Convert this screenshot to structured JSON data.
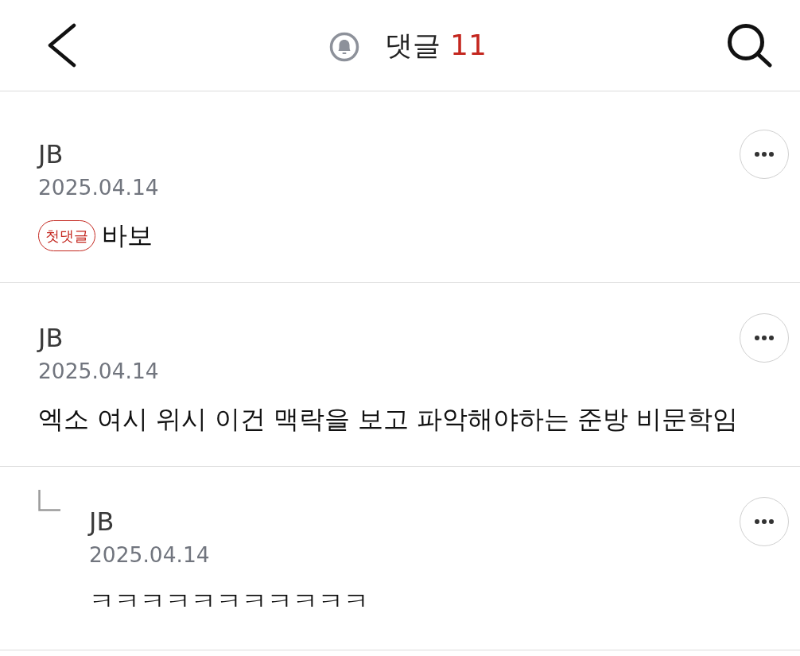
{
  "header": {
    "title": "댓글",
    "count": "11"
  },
  "comments": [
    {
      "author": "JB",
      "date": "2025.04.14",
      "badge": "첫댓글",
      "text": "바보"
    },
    {
      "author": "JB",
      "date": "2025.04.14",
      "text": "엑소 여시 위시 이건 맥락을 보고 파악해야하는 준방 비문학임",
      "replies": [
        {
          "author": "JB",
          "date": "2025.04.14",
          "text": "ㅋㅋㅋㅋㅋㅋㅋㅋㅋㅋㅋ"
        }
      ]
    }
  ]
}
